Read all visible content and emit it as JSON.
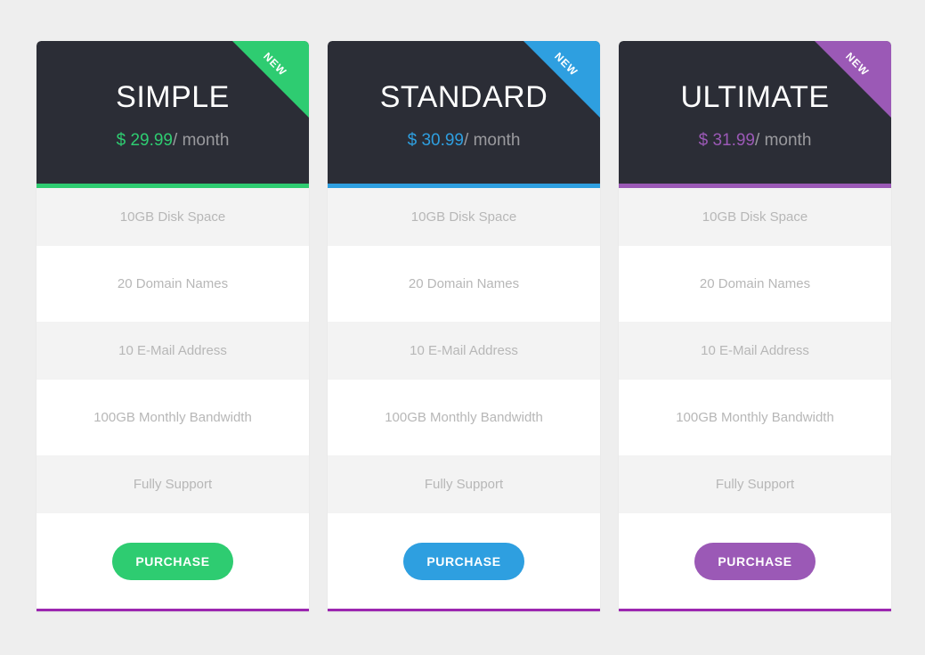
{
  "page": {
    "background_color": "#eeeeee",
    "header_background": "#2b2d36",
    "feature_text_color": "#b7b7b7",
    "row_shaded_color": "#f3f3f3",
    "row_plain_color": "#ffffff",
    "period_color": "#9a9a9e",
    "card_bottom_border_color": "#9c27b0"
  },
  "plans": [
    {
      "id": "simple",
      "title": "SIMPLE",
      "currency": "$",
      "price": "29.99",
      "price_display": "$ 29.99",
      "period": "/ month",
      "accent_color": "#2ecc71",
      "button_color": "#2ecc71",
      "ribbon_label": "NEW",
      "ribbon_color": "#2ecc71",
      "bottom_border_color": "#9c27b0",
      "button_label": "PURCHASE",
      "features": [
        "10GB Disk Space",
        "20 Domain Names",
        "10 E-Mail Address",
        "100GB Monthly Bandwidth",
        "Fully Support"
      ]
    },
    {
      "id": "standard",
      "title": "STANDARD",
      "currency": "$",
      "price": "30.99",
      "price_display": "$ 30.99",
      "period": "/ month",
      "accent_color": "#2e9fe0",
      "button_color": "#2e9fe0",
      "ribbon_label": "NEW",
      "ribbon_color": "#2e9fe0",
      "bottom_border_color": "#9c27b0",
      "button_label": "PURCHASE",
      "features": [
        "10GB Disk Space",
        "20 Domain Names",
        "10 E-Mail Address",
        "100GB Monthly Bandwidth",
        "Fully Support"
      ]
    },
    {
      "id": "ultimate",
      "title": "ULTIMATE",
      "currency": "$",
      "price": "31.99",
      "price_display": "$ 31.99",
      "period": "/ month",
      "accent_color": "#9b59b6",
      "button_color": "#9b59b6",
      "ribbon_label": "NEW",
      "ribbon_color": "#9b59b6",
      "bottom_border_color": "#9c27b0",
      "button_label": "PURCHASE",
      "features": [
        "10GB Disk Space",
        "20 Domain Names",
        "10 E-Mail Address",
        "100GB Monthly Bandwidth",
        "Fully Support"
      ]
    }
  ]
}
